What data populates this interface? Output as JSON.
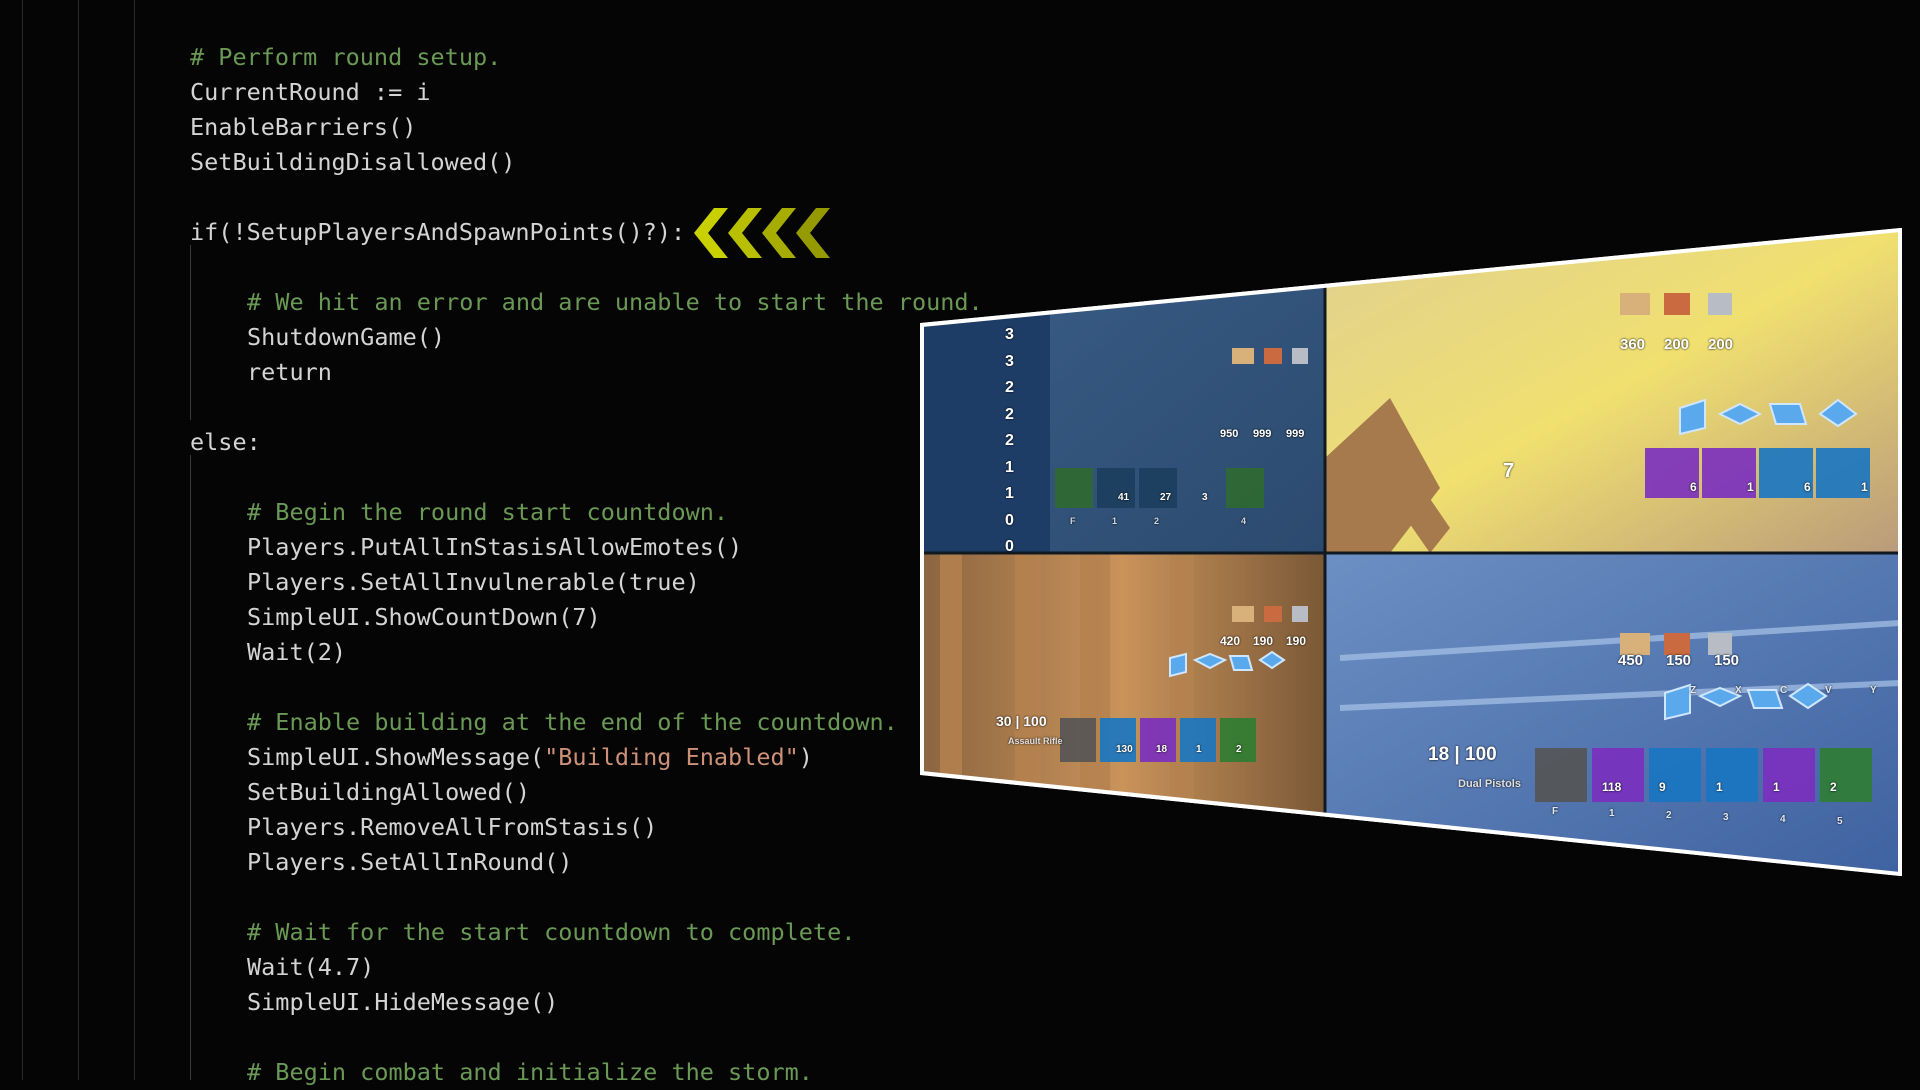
{
  "editor": {
    "lines": [
      {
        "indent": 1,
        "type": "comment",
        "text": "# Perform round setup."
      },
      {
        "indent": 1,
        "type": "code",
        "text": "CurrentRound := i"
      },
      {
        "indent": 1,
        "type": "code",
        "text": "EnableBarriers()"
      },
      {
        "indent": 1,
        "type": "code",
        "text": "SetBuildingDisallowed()"
      },
      {
        "indent": 1,
        "type": "blank",
        "text": ""
      },
      {
        "indent": 1,
        "type": "code",
        "text": "if(!SetupPlayersAndSpawnPoints()?):"
      },
      {
        "indent": 1,
        "type": "blank",
        "text": ""
      },
      {
        "indent": 2,
        "type": "comment",
        "text": "# We hit an error and are unable to start the round."
      },
      {
        "indent": 2,
        "type": "code",
        "text": "ShutdownGame()"
      },
      {
        "indent": 2,
        "type": "code",
        "text": "return"
      },
      {
        "indent": 1,
        "type": "blank",
        "text": ""
      },
      {
        "indent": 1,
        "type": "code",
        "text": "else:"
      },
      {
        "indent": 1,
        "type": "blank",
        "text": ""
      },
      {
        "indent": 2,
        "type": "comment",
        "text": "# Begin the round start countdown."
      },
      {
        "indent": 2,
        "type": "code",
        "text": "Players.PutAllInStasisAllowEmotes()"
      },
      {
        "indent": 2,
        "type": "code",
        "text": "Players.SetAllInvulnerable(true)"
      },
      {
        "indent": 2,
        "type": "code",
        "text": "SimpleUI.ShowCountDown(7)"
      },
      {
        "indent": 2,
        "type": "code",
        "text": "Wait(2)"
      },
      {
        "indent": 1,
        "type": "blank",
        "text": ""
      },
      {
        "indent": 2,
        "type": "comment",
        "text": "# Enable building at the end of the countdown."
      },
      {
        "indent": 2,
        "type": "string-call",
        "prefix": "SimpleUI.ShowMessage(",
        "string": "\"Building Enabled\"",
        "suffix": ")"
      },
      {
        "indent": 2,
        "type": "code",
        "text": "SetBuildingAllowed()"
      },
      {
        "indent": 2,
        "type": "code",
        "text": "Players.RemoveAllFromStasis()"
      },
      {
        "indent": 2,
        "type": "code",
        "text": "Players.SetAllInRound()"
      },
      {
        "indent": 1,
        "type": "blank",
        "text": ""
      },
      {
        "indent": 2,
        "type": "comment",
        "text": "# Wait for the start countdown to complete."
      },
      {
        "indent": 2,
        "type": "code",
        "text": "Wait(4.7)"
      },
      {
        "indent": 2,
        "type": "code",
        "text": "SimpleUI.HideMessage()"
      },
      {
        "indent": 1,
        "type": "blank",
        "text": ""
      },
      {
        "indent": 2,
        "type": "comment",
        "text": "# Begin combat and initialize the storm."
      }
    ]
  },
  "colors": {
    "code": "#d4d4d4",
    "comment": "#6a9955",
    "string": "#ce9178",
    "arrow": "#c8d000",
    "background": "#050505"
  },
  "gameplay": {
    "scoreboard": [
      "3",
      "3",
      "2",
      "2",
      "2",
      "1",
      "1",
      "0",
      "0"
    ],
    "top_left": {
      "materials": [
        "950",
        "999",
        "999"
      ],
      "slots": [
        "F",
        "1",
        "2",
        "4"
      ],
      "ammo": [
        "41",
        "27",
        "3"
      ]
    },
    "top_right": {
      "materials": [
        "360",
        "200",
        "200"
      ],
      "countdown": "7",
      "slots_counts": [
        "6",
        "1",
        "6",
        "1"
      ]
    },
    "bottom_left": {
      "materials": [
        "420",
        "190",
        "190"
      ],
      "ammo_status": "30 | 100",
      "weapon_name": "Assault Rifle",
      "ammo_counts": [
        "130",
        "18",
        "1",
        "2"
      ]
    },
    "bottom_right": {
      "materials": [
        "450",
        "150",
        "150"
      ],
      "build_keys": [
        "Z",
        "X",
        "C",
        "V",
        "Y"
      ],
      "ammo_status": "18 | 100",
      "weapon_name": "Dual Pistols",
      "slot_counts": [
        "118",
        "9",
        "1",
        "1",
        "2"
      ],
      "slot_keys": [
        "F",
        "1",
        "2",
        "3",
        "4",
        "5"
      ]
    }
  }
}
